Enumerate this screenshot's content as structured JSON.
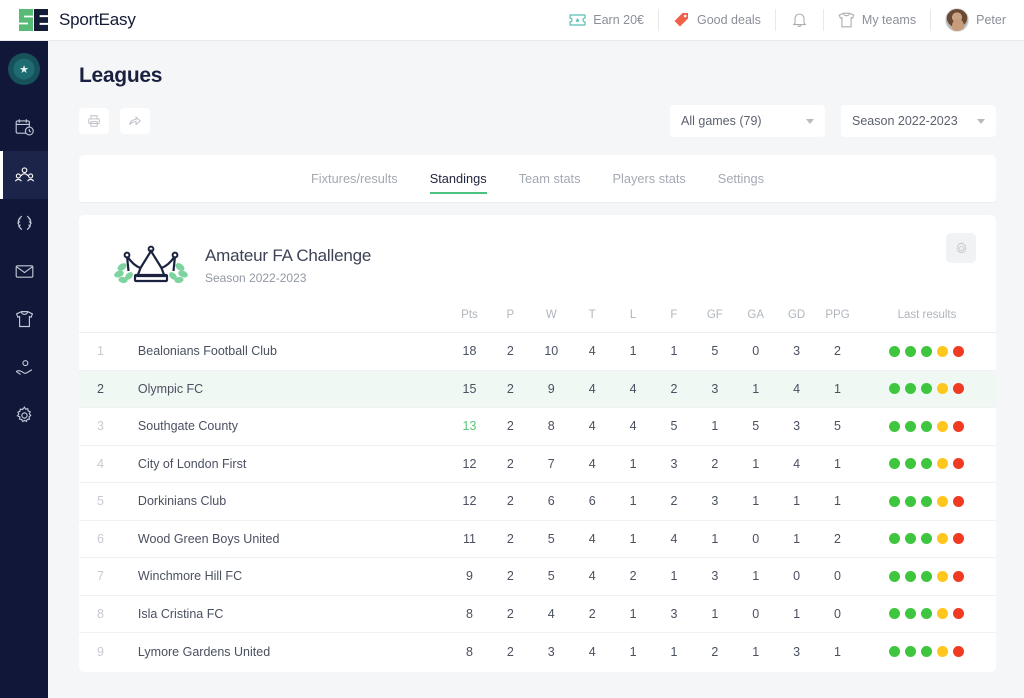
{
  "brand": {
    "name": "SportEasy",
    "logo_icon": "se-logo-icon"
  },
  "topbar": {
    "items": [
      {
        "label": "Earn 20€",
        "icon": "ticket-icon"
      },
      {
        "label": "Good deals",
        "icon": "price-tag-icon"
      },
      {
        "label": "",
        "icon": "bell-icon"
      },
      {
        "label": "My teams",
        "icon": "jersey-icon"
      },
      {
        "label": "Peter",
        "icon": "avatar-icon"
      }
    ]
  },
  "sidebar": {
    "club_badge": "club-badge-icon",
    "items": [
      {
        "name": "calendar",
        "icon": "calendar-clock-icon",
        "active": false
      },
      {
        "name": "members",
        "icon": "people-group-icon",
        "active": true
      },
      {
        "name": "competitions",
        "icon": "laurel-wreath-icon",
        "active": false
      },
      {
        "name": "messages",
        "icon": "envelope-icon",
        "active": false
      },
      {
        "name": "shop",
        "icon": "jersey-icon",
        "active": false
      },
      {
        "name": "sponsors",
        "icon": "hand-coin-icon",
        "active": false
      },
      {
        "name": "settings",
        "icon": "gear-icon",
        "active": false
      }
    ]
  },
  "page": {
    "title": "Leagues"
  },
  "toolbar": {
    "print_icon": "printer-icon",
    "share_icon": "share-arrow-icon",
    "games_select": {
      "value": "All games (79)"
    },
    "season_select": {
      "value": "Season 2022-2023"
    }
  },
  "tabs": [
    {
      "label": "Fixtures/results",
      "active": false
    },
    {
      "label": "Standings",
      "active": true
    },
    {
      "label": "Team stats",
      "active": false
    },
    {
      "label": "Players stats",
      "active": false
    },
    {
      "label": "Settings",
      "active": false
    }
  ],
  "league": {
    "icon": "crown-laurel-icon",
    "name": "Amateur FA Challenge",
    "season": "Season 2022-2023",
    "settings_icon": "gear-icon"
  },
  "table": {
    "headers": {
      "rank": "",
      "team": "",
      "stats": [
        "Pts",
        "P",
        "W",
        "T",
        "L",
        "F",
        "GF",
        "GA",
        "GD",
        "PPG"
      ],
      "last": "Last results"
    },
    "rows": [
      {
        "rank": "1",
        "team": "Bealonians Football Club",
        "pts": "18",
        "pts_green": false,
        "highlight": false,
        "stats": [
          "2",
          "10",
          "4",
          "1",
          "1",
          "5",
          "0",
          "3",
          "2"
        ],
        "last": [
          "W",
          "W",
          "W",
          "D",
          "L"
        ]
      },
      {
        "rank": "2",
        "team": "Olympic FC",
        "pts": "15",
        "pts_green": false,
        "highlight": true,
        "stats": [
          "2",
          "9",
          "4",
          "4",
          "2",
          "3",
          "1",
          "4",
          "1"
        ],
        "last": [
          "W",
          "W",
          "W",
          "D",
          "L"
        ]
      },
      {
        "rank": "3",
        "team": "Southgate County",
        "pts": "13",
        "pts_green": true,
        "highlight": false,
        "stats": [
          "2",
          "8",
          "4",
          "4",
          "5",
          "1",
          "5",
          "3",
          "5"
        ],
        "last": [
          "W",
          "W",
          "W",
          "D",
          "L"
        ]
      },
      {
        "rank": "4",
        "team": "City of London First",
        "pts": "12",
        "pts_green": false,
        "highlight": false,
        "stats": [
          "2",
          "7",
          "4",
          "1",
          "3",
          "2",
          "1",
          "4",
          "1"
        ],
        "last": [
          "W",
          "W",
          "W",
          "D",
          "L"
        ]
      },
      {
        "rank": "5",
        "team": "Dorkinians Club",
        "pts": "12",
        "pts_green": false,
        "highlight": false,
        "stats": [
          "2",
          "6",
          "6",
          "1",
          "2",
          "3",
          "1",
          "1",
          "1"
        ],
        "last": [
          "W",
          "W",
          "W",
          "D",
          "L"
        ]
      },
      {
        "rank": "6",
        "team": "Wood Green Boys United",
        "pts": "11",
        "pts_green": false,
        "highlight": false,
        "stats": [
          "2",
          "5",
          "4",
          "1",
          "4",
          "1",
          "0",
          "1",
          "2"
        ],
        "last": [
          "W",
          "W",
          "W",
          "D",
          "L"
        ]
      },
      {
        "rank": "7",
        "team": "Winchmore Hill FC",
        "pts": "9",
        "pts_green": false,
        "highlight": false,
        "stats": [
          "2",
          "5",
          "4",
          "2",
          "1",
          "3",
          "1",
          "0",
          "0"
        ],
        "last": [
          "W",
          "W",
          "W",
          "D",
          "L"
        ]
      },
      {
        "rank": "8",
        "team": " Isla Cristina FC",
        "pts": "8",
        "pts_green": false,
        "highlight": false,
        "stats": [
          "2",
          "4",
          "2",
          "1",
          "3",
          "1",
          "0",
          "1",
          "0"
        ],
        "last": [
          "W",
          "W",
          "W",
          "D",
          "L"
        ]
      },
      {
        "rank": "9",
        "team": "Lymore Gardens United",
        "pts": "8",
        "pts_green": false,
        "highlight": false,
        "stats": [
          "2",
          "3",
          "4",
          "1",
          "1",
          "2",
          "1",
          "3",
          "1"
        ],
        "last": [
          "W",
          "W",
          "W",
          "D",
          "L"
        ]
      }
    ]
  },
  "colors": {
    "accent_green": "#4cc47f",
    "sidebar_bg": "#101738",
    "win": "#3fc63f",
    "draw": "#ffc71e",
    "loss": "#f03a22",
    "highlight_row": "#f0f8f3"
  }
}
